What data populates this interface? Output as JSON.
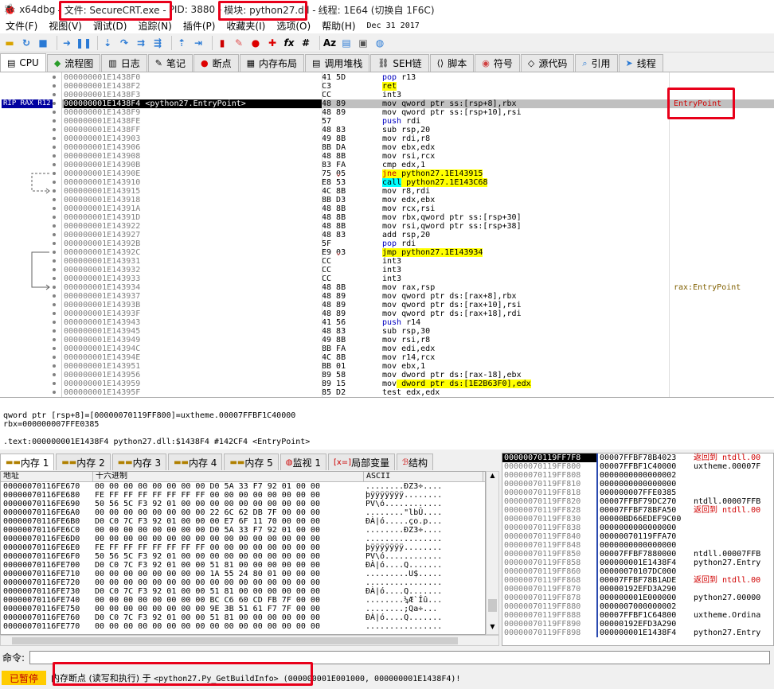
{
  "window": {
    "app": "x64dbg",
    "file": "- 文件: SecureCRT.exe -",
    "pid": "PID: 3880 -",
    "module": "模块: python27.dll -",
    "thread": "线程: 1E64 (切换自 1F6C)"
  },
  "menu": [
    "文件(F)",
    "视图(V)",
    "调试(D)",
    "追踪(N)",
    "插件(P)",
    "收藏夹(I)",
    "选项(O)",
    "帮助(H)",
    "Dec 31 2017"
  ],
  "tabs": [
    {
      "label": "CPU",
      "icon": "cpu-icon"
    },
    {
      "label": "流程图",
      "icon": "graph-icon"
    },
    {
      "label": "日志",
      "icon": "log-icon"
    },
    {
      "label": "笔记",
      "icon": "notes-icon"
    },
    {
      "label": "断点",
      "icon": "breakpoint-icon"
    },
    {
      "label": "内存布局",
      "icon": "memory-map-icon"
    },
    {
      "label": "调用堆栈",
      "icon": "callstack-icon"
    },
    {
      "label": "SEH链",
      "icon": "seh-icon"
    },
    {
      "label": "脚本",
      "icon": "script-icon"
    },
    {
      "label": "符号",
      "icon": "symbols-icon"
    },
    {
      "label": "源代码",
      "icon": "source-icon"
    },
    {
      "label": "引用",
      "icon": "references-icon"
    },
    {
      "label": "线程",
      "icon": "threads-icon"
    }
  ],
  "regs_label": "RIP RAX R12",
  "addresses": [
    "000000001E1438F0",
    "000000001E1438F2",
    "000000001E1438F3",
    "000000001E1438F4 <python27.EntryPoint>",
    "000000001E1438F9",
    "000000001E1438FE",
    "000000001E1438FF",
    "000000001E143903",
    "000000001E143906",
    "000000001E143908",
    "000000001E14390B",
    "000000001E14390E",
    "000000001E143910",
    "000000001E143915",
    "000000001E143918",
    "000000001E14391A",
    "000000001E14391D",
    "000000001E143922",
    "000000001E143927",
    "000000001E14392B",
    "000000001E14392C",
    "000000001E143931",
    "000000001E143932",
    "000000001E143933",
    "000000001E143934",
    "000000001E143937",
    "000000001E14393B",
    "000000001E14393F",
    "000000001E143943",
    "000000001E143945",
    "000000001E143949",
    "000000001E14394C",
    "000000001E14394E",
    "000000001E143951",
    "000000001E143956",
    "000000001E143959",
    "000000001E14395F"
  ],
  "bytes": [
    "41 5D",
    "C3",
    "CC",
    "48 89",
    "48 89",
    "57",
    "48 83",
    "49 8B",
    "8B DA",
    "48 8B",
    "83 FA",
    "75 05",
    "E8 53",
    "4C 8B",
    "8B D3",
    "48 8B",
    "48 8B",
    "48 8B",
    "48 83",
    "5F",
    "E9 03",
    "CC",
    "CC",
    "CC",
    "48 8B",
    "48 89",
    "48 89",
    "48 89",
    "41 56",
    "48 83",
    "49 8B",
    "8B FA",
    "4C 8B",
    "BB 01",
    "89 58",
    "89 15",
    "85 D2"
  ],
  "disasm": [
    "pop r13",
    "ret",
    "int3",
    "mov qword ptr ss:[rsp+8],rbx",
    "mov qword ptr ss:[rsp+10],rsi",
    "push rdi",
    "sub rsp,20",
    "mov rdi,r8",
    "mov ebx,edx",
    "mov rsi,rcx",
    "cmp edx,1",
    "jne python27.1E143915",
    "call python27.1E143C68",
    "mov r8,rdi",
    "mov edx,ebx",
    "mov rcx,rsi",
    "mov rbx,qword ptr ss:[rsp+30]",
    "mov rsi,qword ptr ss:[rsp+38]",
    "add rsp,20",
    "pop rdi",
    "jmp python27.1E143934",
    "int3",
    "int3",
    "int3",
    "mov rax,rsp",
    "mov qword ptr ds:[rax+8],rbx",
    "mov qword ptr ds:[rax+10],rsi",
    "mov qword ptr ds:[rax+18],rdi",
    "push r14",
    "sub rsp,30",
    "mov rsi,r8",
    "mov edi,edx",
    "mov r14,rcx",
    "mov ebx,1",
    "mov dword ptr ds:[rax-18],ebx",
    "mov dword ptr ds:[1E2B63F0],edx",
    "test edx,edx"
  ],
  "comments": {
    "entry": "EntryPoint",
    "rax": "rax:EntryPoint"
  },
  "info": {
    "line1": "qword ptr [rsp+8]=[00000070119FF800]=uxtheme.00007FFBF1C40000",
    "line2": "rbx=000000007FFE0385",
    "line3": ".text:000000001E1438F4 python27.dll:$1438F4 #142CF4 <EntryPoint>"
  },
  "mem_tabs": [
    "内存 1",
    "内存 2",
    "内存 3",
    "内存 4",
    "内存 5",
    "监视 1",
    "局部变量",
    "结构"
  ],
  "dump_headers": [
    "地址",
    "十六进制",
    "ASCII"
  ],
  "dump_rows": [
    {
      "a": "00000070116FE670",
      "h": "00 00 00 00 00 00 00 00  D0 5A 33 F7 92 01 00 00",
      "s": "........ÐZ3÷...."
    },
    {
      "a": "00000070116FE680",
      "h": "FE FF FF FF FF FF FF FF  00 00 00 00 00 00 00 00",
      "s": "þÿÿÿÿÿÿÿ........"
    },
    {
      "a": "00000070116FE690",
      "h": "50 56 5C F3 92 01 00 00  00 00 00 00 00 00 00 00",
      "s": "PV\\ó............"
    },
    {
      "a": "00000070116FE6A0",
      "h": "00 00 00 00 00 00 00 00  22 6C 62 DB 7F 00 00 00",
      "s": "........\"lbÛ...."
    },
    {
      "a": "00000070116FE6B0",
      "h": "D0 C0 7C F3 92 01 00 00  00 E7 6F 11 70 00 00 00",
      "s": "ÐÀ|ó.....ço.p..."
    },
    {
      "a": "00000070116FE6C0",
      "h": "00 00 00 00 00 00 00 00  D0 5A 33 F7 92 01 00 00",
      "s": "........ÐZ3÷...."
    },
    {
      "a": "00000070116FE6D0",
      "h": "00 00 00 00 00 00 00 00  00 00 00 00 00 00 00 00",
      "s": "................"
    },
    {
      "a": "00000070116FE6E0",
      "h": "FE FF FF FF FF FF FF FF  00 00 00 00 00 00 00 00",
      "s": "þÿÿÿÿÿÿÿ........"
    },
    {
      "a": "00000070116FE6F0",
      "h": "50 56 5C F3 92 01 00 00  00 00 00 00 00 00 00 00",
      "s": "PV\\ó............"
    },
    {
      "a": "00000070116FE700",
      "h": "D0 C0 7C F3 92 01 00 00  51 81 00 00 00 00 00 00",
      "s": "ÐÀ|ó....Q......."
    },
    {
      "a": "00000070116FE710",
      "h": "00 00 00 00 00 00 00 00  1A 55 24 80 01 00 00 00",
      "s": ".........U$....."
    },
    {
      "a": "00000070116FE720",
      "h": "00 00 00 00 00 00 00 00  00 00 00 00 00 00 00 00",
      "s": "................"
    },
    {
      "a": "00000070116FE730",
      "h": "D0 C0 7C F3 92 01 00 00  51 81 00 00 00 00 00 00",
      "s": "ÐÀ|ó....Q......."
    },
    {
      "a": "00000070116FE740",
      "h": "00 00 00 00 00 00 00 00  BC C6 60 CD FB 7F 00 00",
      "s": "........¼Æ`Íû..."
    },
    {
      "a": "00000070116FE750",
      "h": "00 00 00 00 00 00 00 00  9E 3B 51 61 F7 7F 00 00",
      "s": "........;Qa÷..."
    },
    {
      "a": "00000070116FE760",
      "h": "D0 C0 7C F3 92 01 00 00  51 81 00 00 00 00 00 00",
      "s": "ÐÀ|ó....Q......."
    },
    {
      "a": "00000070116FE770",
      "h": "00 00 00 00 00 00 00 00  00 00 00 00 00 00 00 00",
      "s": "................"
    }
  ],
  "stack_rows": [
    {
      "a": "00000070119FF7F8",
      "v": "00007FFBF78B4023",
      "c": "返回到 ntdll.00"
    },
    {
      "a": "00000070119FF800",
      "v": "00007FFBF1C40000",
      "c": "uxtheme.00007F"
    },
    {
      "a": "00000070119FF808",
      "v": "0000000000000002",
      "c": ""
    },
    {
      "a": "00000070119FF810",
      "v": "0000000000000000",
      "c": ""
    },
    {
      "a": "00000070119FF818",
      "v": "000000007FFE0385",
      "c": ""
    },
    {
      "a": "00000070119FF820",
      "v": "00007FFBF79DC270",
      "c": "ntdll.00007FFB"
    },
    {
      "a": "00000070119FF828",
      "v": "00007FFBF78BFA50",
      "c": "返回到 ntdll.00"
    },
    {
      "a": "00000070119FF830",
      "v": "00000BD66EDEF9C00",
      "c": ""
    },
    {
      "a": "00000070119FF838",
      "v": "0000000000000000",
      "c": ""
    },
    {
      "a": "00000070119FF840",
      "v": "00000070119FFA70",
      "c": ""
    },
    {
      "a": "00000070119FF848",
      "v": "0000000000000000",
      "c": ""
    },
    {
      "a": "00000070119FF850",
      "v": "00007FFBF7880000",
      "c": "ntdll.00007FFB"
    },
    {
      "a": "00000070119FF858",
      "v": "000000001E1438F4",
      "c": "python27.Entry"
    },
    {
      "a": "00000070119FF860",
      "v": "00000070107DC000",
      "c": ""
    },
    {
      "a": "00000070119FF868",
      "v": "00007FFBF78B1ADE",
      "c": "返回到 ntdll.00"
    },
    {
      "a": "00000070119FF870",
      "v": "00000192EFD3A290",
      "c": ""
    },
    {
      "a": "00000070119FF878",
      "v": "000000001E000000",
      "c": "python27.00000"
    },
    {
      "a": "00000070119FF880",
      "v": "0000007000000002",
      "c": ""
    },
    {
      "a": "00000070119FF888",
      "v": "00007FFBF1C64800",
      "c": "uxtheme.Ordina"
    },
    {
      "a": "00000070119FF890",
      "v": "00000192EFD3A290",
      "c": ""
    },
    {
      "a": "00000070119FF898",
      "v": "000000001E1438F4",
      "c": "python27.Entry"
    }
  ],
  "command_label": "命令:",
  "command_value": "",
  "status": {
    "state": "已暂停",
    "msg_prefix": "内存断点 (读写和执行) 于 ",
    "msg_target": "<python27.Py_GetBuildInfo>",
    "msg_suffix": " (000000001E001000, 000000001E1438F4)!"
  }
}
